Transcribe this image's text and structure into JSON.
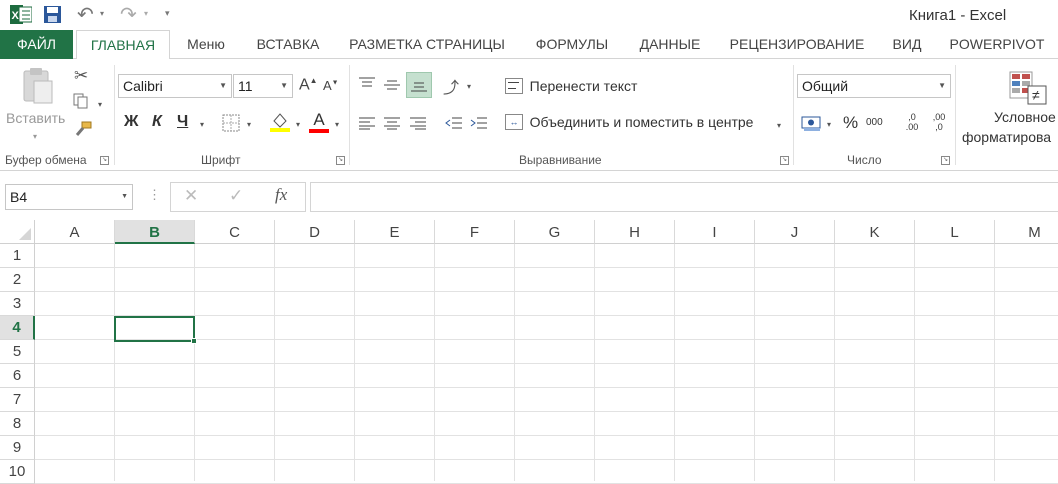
{
  "title": "Книга1 - Excel",
  "qat": {
    "undo": "↶",
    "redo": "↷",
    "more": "▾"
  },
  "tabs": {
    "file": "ФАЙЛ",
    "home": "ГЛАВНАЯ",
    "menu": "Меню",
    "insert": "ВСТАВКА",
    "layout": "РАЗМЕТКА СТРАНИЦЫ",
    "formulas": "ФОРМУЛЫ",
    "data": "ДАННЫЕ",
    "review": "РЕЦЕНЗИРОВАНИЕ",
    "view": "ВИД",
    "powerpivot": "POWERPIVOT"
  },
  "clipboard": {
    "paste": "Вставить",
    "label": "Буфер обмена"
  },
  "font": {
    "name": "Calibri",
    "size": "11",
    "bold": "Ж",
    "italic": "К",
    "underline": "Ч",
    "label": "Шрифт",
    "grow": "A",
    "shrink": "A",
    "color_letter": "A",
    "fill_color": "#ffff00",
    "font_color": "#ff0000"
  },
  "alignment": {
    "wrap": "Перенести текст",
    "merge": "Объединить и поместить в центре",
    "label": "Выравнивание"
  },
  "number": {
    "format": "Общий",
    "percent": "%",
    "thousands": "000",
    "inc": ",0 .00",
    "dec": ",00 ,0",
    "label": "Число"
  },
  "styles": {
    "cond1": "Условное",
    "cond2": "форматирова"
  },
  "formula_bar": {
    "name_box": "B4",
    "fx": "fx",
    "cancel": "✕",
    "enter": "✓",
    "dots": "⋮",
    "value": ""
  },
  "sheet": {
    "columns": [
      "A",
      "B",
      "C",
      "D",
      "E",
      "F",
      "G",
      "H",
      "I",
      "J",
      "K",
      "L",
      "M"
    ],
    "rows": [
      "1",
      "2",
      "3",
      "4",
      "5",
      "6",
      "7",
      "8",
      "9",
      "10"
    ],
    "active_cell": "B4",
    "accent": "#217346"
  }
}
